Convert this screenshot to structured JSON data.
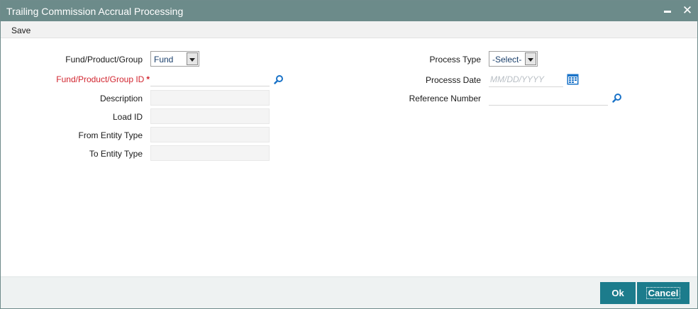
{
  "window": {
    "title": "Trailing Commission Accrual Processing"
  },
  "menu": {
    "save_label": "Save"
  },
  "form": {
    "fund_product_group": {
      "label": "Fund/Product/Group",
      "value": "Fund"
    },
    "fund_product_group_id": {
      "label": "Fund/Product/Group ID",
      "required_marker": "*",
      "value": ""
    },
    "description": {
      "label": "Description",
      "value": ""
    },
    "load_id": {
      "label": "Load ID",
      "value": ""
    },
    "from_entity_type": {
      "label": "From Entity Type",
      "value": ""
    },
    "to_entity_type": {
      "label": "To Entity Type",
      "value": ""
    },
    "process_type": {
      "label": "Process Type",
      "value": "-Select-"
    },
    "process_date": {
      "label": "Processs Date",
      "placeholder": "MM/DD/YYYY",
      "value": ""
    },
    "reference_number": {
      "label": "Reference Number",
      "value": ""
    }
  },
  "footer": {
    "ok_label": "Ok",
    "cancel_label": "Cancel"
  },
  "colors": {
    "titlebar": "#6c8b8a",
    "button": "#1c7c8c",
    "required_label": "#d22630",
    "icon_blue": "#1a73c8"
  },
  "icons": {
    "lookup": "search-icon",
    "calendar": "calendar-icon",
    "minimize": "minimize-icon",
    "close": "close-icon"
  }
}
